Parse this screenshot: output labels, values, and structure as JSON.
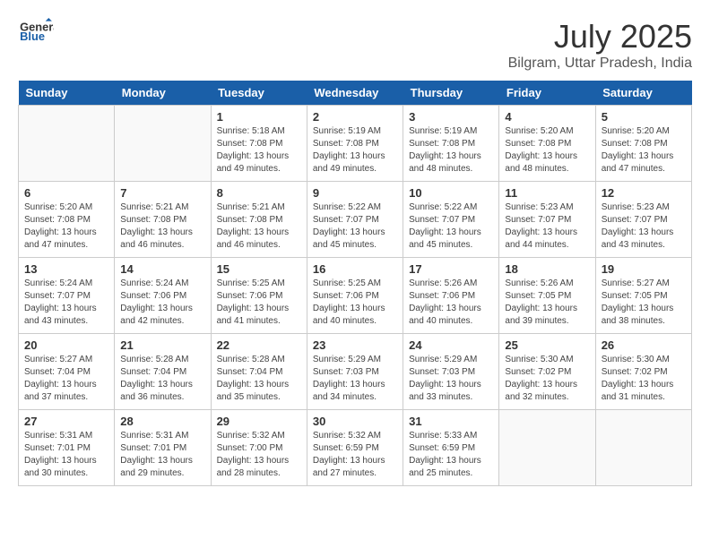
{
  "header": {
    "logo_general": "General",
    "logo_blue": "Blue",
    "month_year": "July 2025",
    "location": "Bilgram, Uttar Pradesh, India"
  },
  "days_of_week": [
    "Sunday",
    "Monday",
    "Tuesday",
    "Wednesday",
    "Thursday",
    "Friday",
    "Saturday"
  ],
  "weeks": [
    [
      {
        "day": "",
        "info": ""
      },
      {
        "day": "",
        "info": ""
      },
      {
        "day": "1",
        "info": "Sunrise: 5:18 AM\nSunset: 7:08 PM\nDaylight: 13 hours and 49 minutes."
      },
      {
        "day": "2",
        "info": "Sunrise: 5:19 AM\nSunset: 7:08 PM\nDaylight: 13 hours and 49 minutes."
      },
      {
        "day": "3",
        "info": "Sunrise: 5:19 AM\nSunset: 7:08 PM\nDaylight: 13 hours and 48 minutes."
      },
      {
        "day": "4",
        "info": "Sunrise: 5:20 AM\nSunset: 7:08 PM\nDaylight: 13 hours and 48 minutes."
      },
      {
        "day": "5",
        "info": "Sunrise: 5:20 AM\nSunset: 7:08 PM\nDaylight: 13 hours and 47 minutes."
      }
    ],
    [
      {
        "day": "6",
        "info": "Sunrise: 5:20 AM\nSunset: 7:08 PM\nDaylight: 13 hours and 47 minutes."
      },
      {
        "day": "7",
        "info": "Sunrise: 5:21 AM\nSunset: 7:08 PM\nDaylight: 13 hours and 46 minutes."
      },
      {
        "day": "8",
        "info": "Sunrise: 5:21 AM\nSunset: 7:08 PM\nDaylight: 13 hours and 46 minutes."
      },
      {
        "day": "9",
        "info": "Sunrise: 5:22 AM\nSunset: 7:07 PM\nDaylight: 13 hours and 45 minutes."
      },
      {
        "day": "10",
        "info": "Sunrise: 5:22 AM\nSunset: 7:07 PM\nDaylight: 13 hours and 45 minutes."
      },
      {
        "day": "11",
        "info": "Sunrise: 5:23 AM\nSunset: 7:07 PM\nDaylight: 13 hours and 44 minutes."
      },
      {
        "day": "12",
        "info": "Sunrise: 5:23 AM\nSunset: 7:07 PM\nDaylight: 13 hours and 43 minutes."
      }
    ],
    [
      {
        "day": "13",
        "info": "Sunrise: 5:24 AM\nSunset: 7:07 PM\nDaylight: 13 hours and 43 minutes."
      },
      {
        "day": "14",
        "info": "Sunrise: 5:24 AM\nSunset: 7:06 PM\nDaylight: 13 hours and 42 minutes."
      },
      {
        "day": "15",
        "info": "Sunrise: 5:25 AM\nSunset: 7:06 PM\nDaylight: 13 hours and 41 minutes."
      },
      {
        "day": "16",
        "info": "Sunrise: 5:25 AM\nSunset: 7:06 PM\nDaylight: 13 hours and 40 minutes."
      },
      {
        "day": "17",
        "info": "Sunrise: 5:26 AM\nSunset: 7:06 PM\nDaylight: 13 hours and 40 minutes."
      },
      {
        "day": "18",
        "info": "Sunrise: 5:26 AM\nSunset: 7:05 PM\nDaylight: 13 hours and 39 minutes."
      },
      {
        "day": "19",
        "info": "Sunrise: 5:27 AM\nSunset: 7:05 PM\nDaylight: 13 hours and 38 minutes."
      }
    ],
    [
      {
        "day": "20",
        "info": "Sunrise: 5:27 AM\nSunset: 7:04 PM\nDaylight: 13 hours and 37 minutes."
      },
      {
        "day": "21",
        "info": "Sunrise: 5:28 AM\nSunset: 7:04 PM\nDaylight: 13 hours and 36 minutes."
      },
      {
        "day": "22",
        "info": "Sunrise: 5:28 AM\nSunset: 7:04 PM\nDaylight: 13 hours and 35 minutes."
      },
      {
        "day": "23",
        "info": "Sunrise: 5:29 AM\nSunset: 7:03 PM\nDaylight: 13 hours and 34 minutes."
      },
      {
        "day": "24",
        "info": "Sunrise: 5:29 AM\nSunset: 7:03 PM\nDaylight: 13 hours and 33 minutes."
      },
      {
        "day": "25",
        "info": "Sunrise: 5:30 AM\nSunset: 7:02 PM\nDaylight: 13 hours and 32 minutes."
      },
      {
        "day": "26",
        "info": "Sunrise: 5:30 AM\nSunset: 7:02 PM\nDaylight: 13 hours and 31 minutes."
      }
    ],
    [
      {
        "day": "27",
        "info": "Sunrise: 5:31 AM\nSunset: 7:01 PM\nDaylight: 13 hours and 30 minutes."
      },
      {
        "day": "28",
        "info": "Sunrise: 5:31 AM\nSunset: 7:01 PM\nDaylight: 13 hours and 29 minutes."
      },
      {
        "day": "29",
        "info": "Sunrise: 5:32 AM\nSunset: 7:00 PM\nDaylight: 13 hours and 28 minutes."
      },
      {
        "day": "30",
        "info": "Sunrise: 5:32 AM\nSunset: 6:59 PM\nDaylight: 13 hours and 27 minutes."
      },
      {
        "day": "31",
        "info": "Sunrise: 5:33 AM\nSunset: 6:59 PM\nDaylight: 13 hours and 25 minutes."
      },
      {
        "day": "",
        "info": ""
      },
      {
        "day": "",
        "info": ""
      }
    ]
  ]
}
